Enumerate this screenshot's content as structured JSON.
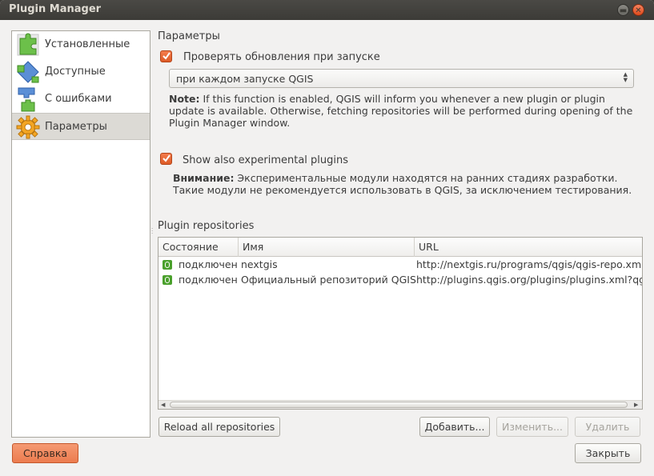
{
  "window": {
    "title": "Plugin Manager"
  },
  "sidebar": {
    "items": [
      {
        "label": "Установленные",
        "icon": "puzzle-green-icon"
      },
      {
        "label": "Доступные",
        "icon": "puzzle-blue-icon"
      },
      {
        "label": "С ошибками",
        "icon": "puzzle-broken-icon"
      },
      {
        "label": "Параметры",
        "icon": "gear-settings-icon",
        "selected": true
      }
    ]
  },
  "params": {
    "title": "Параметры",
    "check_updates": {
      "label": "Проверять обновления при запуске",
      "checked": true
    },
    "interval": {
      "selected": "при каждом запуске QGIS"
    },
    "note_bold": "Note:",
    "note_text": " If this function is enabled, QGIS will inform you whenever a new plugin or plugin update is available. Otherwise, fetching repositories will be performed during opening of the Plugin Manager window.",
    "experimental": {
      "label": "Show also experimental plugins",
      "checked": true
    },
    "warn_bold": "Внимание:",
    "warn_text": " Экспериментальные модули находятся на ранних стадиях разработки. Такие модули не рекомендуется использовать в QGIS, за исключением тестирования."
  },
  "repos": {
    "title": "Plugin repositories",
    "columns": [
      "Состояние",
      "Имя",
      "URL"
    ],
    "rows": [
      {
        "status": "подключен",
        "name": "nextgis",
        "url": "http://nextgis.ru/programs/qgis/qgis-repo.xml"
      },
      {
        "status": "подключен",
        "name": "Официальный репозиторий QGIS",
        "url": "http://plugins.qgis.org/plugins/plugins.xml?qgis"
      }
    ],
    "reload_label": "Reload all repositories",
    "add_label": "Добавить...",
    "edit_label": "Изменить...",
    "delete_label": "Удалить"
  },
  "footer": {
    "help_label": "Справка",
    "close_label": "Закрыть"
  },
  "colors": {
    "accent": "#dd5b27",
    "status_ok": "#4aa02c",
    "title_bar": "#3c3b37"
  }
}
